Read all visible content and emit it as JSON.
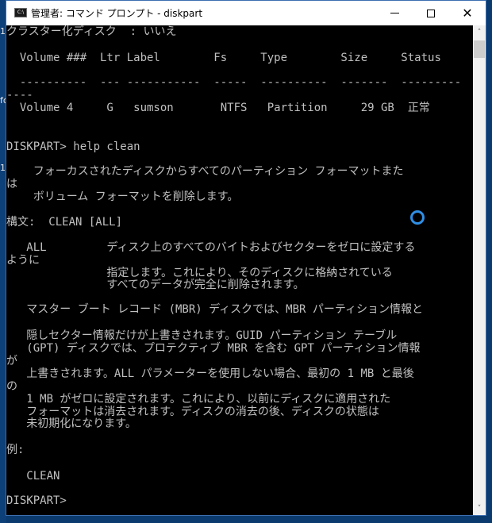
{
  "window": {
    "title": "管理者: コマンド プロンプト - diskpart",
    "icon_label": "C:\\",
    "controls": {
      "minimize": "minimize",
      "maximize": "maximize",
      "close": "✕"
    }
  },
  "desktop_fragments": [
    "1",
    "fo",
    "1"
  ],
  "console": {
    "lines": [
      "クラスター化ディスク  : いいえ",
      "  Volume ###  Ltr Label        Fs     Type        Size     Status     Info",
      "  ----------  --- -----------  -----  ----------  -------  ---------  ----",
      "----",
      "  Volume 4     G   sumson       NTFS   Partition     29 GB  正常",
      "",
      "DISKPART> help clean",
      "    フォーカスされたディスクからすべてのパーティション フォーマットまた",
      "は",
      "    ボリューム フォーマットを削除します。",
      "構文:  CLEAN [ALL]",
      "   ALL         ディスク上のすべてのバイトおよびセクターをゼロに設定する",
      "ように",
      "               指定します。これにより、そのディスクに格納されている",
      "               すべてのデータが完全に削除されます。",
      "   マスター ブート レコード (MBR) ディスクでは、MBR パーティション情報と",
      "   隠しセクター情報だけが上書きされます。GUID パーティション テーブル",
      "   (GPT) ディスクでは、プロテクティブ MBR を含む GPT パーティション情報",
      "が",
      "   上書きされます。ALL パラメーターを使用しない場合、最初の 1 MB と最後",
      "の",
      "   1 MB がゼロに設定されます。これにより、以前にディスクに適用された",
      "   フォーマットは消去されます。ディスクの消去の後、ディスクの状態は",
      "   未初期化になります。",
      "例:",
      "   CLEAN",
      "DISKPART>"
    ]
  },
  "scrollbar": {
    "up": "˄",
    "down": "˅"
  },
  "colors": {
    "console_bg": "#000000",
    "console_fg": "#c0c0c0",
    "titlebar_bg": "#ffffff",
    "busy_cursor": "#2f8fe6"
  }
}
